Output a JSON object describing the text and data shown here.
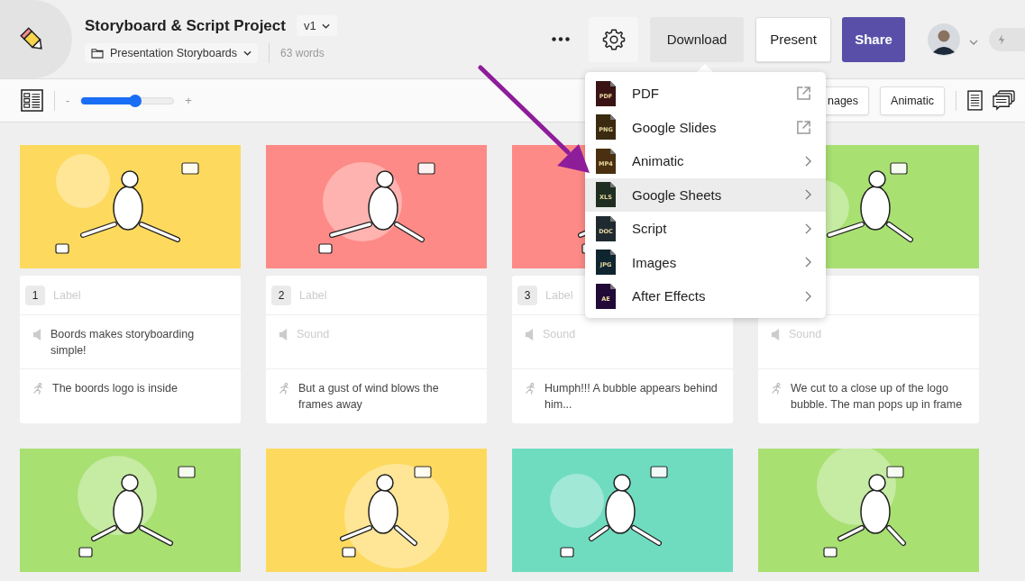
{
  "project": {
    "title": "Storyboard & Script Project",
    "version": "v1",
    "folder": "Presentation Storyboards",
    "word_count": "63 words"
  },
  "header_actions": {
    "download": "Download",
    "present": "Present",
    "share": "Share"
  },
  "toolbar": {
    "zoom_minus": "-",
    "zoom_plus": "+",
    "zoom": {
      "level": 0.58
    },
    "view_buttons": [
      "nages",
      "Animatic"
    ]
  },
  "download_menu": [
    {
      "badge": "PDF",
      "color": "#3a1414",
      "label": "PDF",
      "kind": "external",
      "selected": false
    },
    {
      "badge": "PNG",
      "color": "#3a2a10",
      "label": "Google Slides",
      "kind": "external",
      "selected": false
    },
    {
      "badge": "MP4",
      "color": "#4a3010",
      "label": "Animatic",
      "kind": "submenu",
      "selected": false
    },
    {
      "badge": "XLS",
      "color": "#1f2e20",
      "label": "Google Sheets",
      "kind": "submenu",
      "selected": true
    },
    {
      "badge": "DOC",
      "color": "#1e2a30",
      "label": "Script",
      "kind": "submenu",
      "selected": false
    },
    {
      "badge": "JPG",
      "color": "#0f2530",
      "label": "Images",
      "kind": "submenu",
      "selected": false
    },
    {
      "badge": "AE",
      "color": "#220a38",
      "label": "After Effects",
      "kind": "submenu",
      "selected": false
    }
  ],
  "frames": [
    {
      "color": "#fdd95e",
      "number": "1",
      "label": {
        "placeholder": "Label"
      },
      "sound": {
        "value": "Boords makes storyboarding simple!"
      },
      "action": {
        "value": "The boords logo is inside"
      }
    },
    {
      "color": "#fd8a86",
      "number": "2",
      "label": {
        "placeholder": "Label"
      },
      "sound": {
        "placeholder": "Sound"
      },
      "action": {
        "value": "But a gust of wind blows the frames away"
      }
    },
    {
      "color": "#fd8a86",
      "number": "3",
      "label": {
        "placeholder": "Label"
      },
      "sound": {
        "placeholder": "Sound"
      },
      "action": {
        "value": "Humph!!! A bubble appears behind him..."
      }
    },
    {
      "color": "#a8e072",
      "sound": {
        "placeholder": "Sound"
      },
      "action": {
        "value": "We cut to a close up of the logo bubble. The man pops up in frame"
      }
    },
    {
      "color": "#a8e072"
    },
    {
      "color": "#fdd95e"
    },
    {
      "color": "#6fdcc0"
    },
    {
      "color": "#a8e072"
    }
  ]
}
